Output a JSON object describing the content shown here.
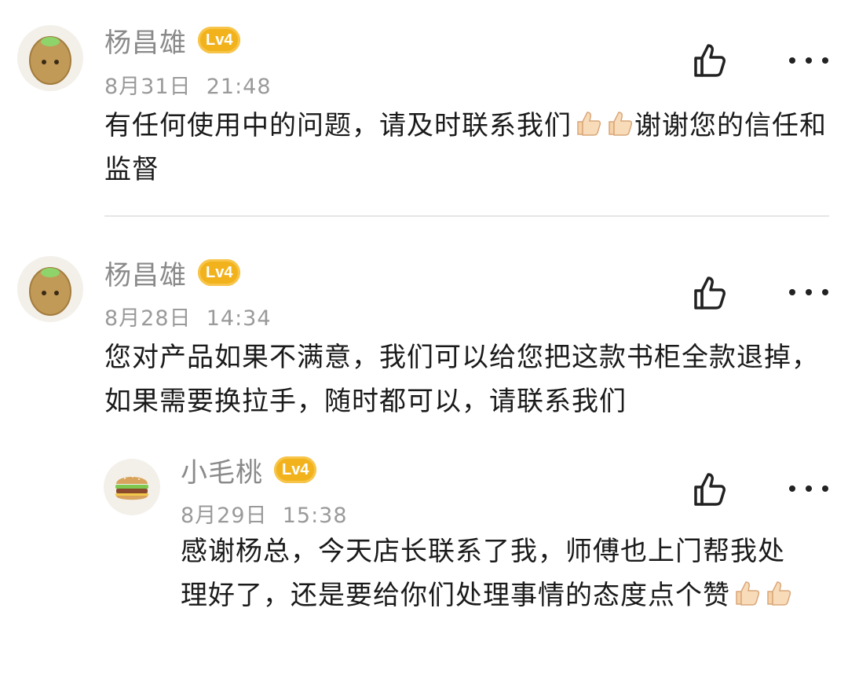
{
  "comments": [
    {
      "author": "杨昌雄",
      "level": "Lv4",
      "date": "8月31日",
      "time": "21:48",
      "text_before": "有任何使用中的问题，请及时联系我们",
      "text_after": "谢谢您的信任和监督",
      "emoji_count": 2
    },
    {
      "author": "杨昌雄",
      "level": "Lv4",
      "date": "8月28日",
      "time": "14:34",
      "text": "您对产品如果不满意，我们可以给您把这款书柜全款退掉，如果需要换拉手，随时都可以，请联系我们",
      "reply": {
        "author": "小毛桃",
        "level": "Lv4",
        "date": "8月29日",
        "time": "15:38",
        "text": "感谢杨总，今天店长联系了我，师傅也上门帮我处理好了，还是要给你们处理事情的态度点个赞",
        "emoji_count": 2
      }
    }
  ],
  "icons": {
    "like": "thumbs-up-outline-icon",
    "more": "more-dots-icon",
    "thumb_emoji": "thumbs-up-emoji"
  },
  "colors": {
    "badge": "#f2b21c",
    "name": "#8a8a8a",
    "meta": "#9a9a9a",
    "text": "#1a1a1a"
  }
}
